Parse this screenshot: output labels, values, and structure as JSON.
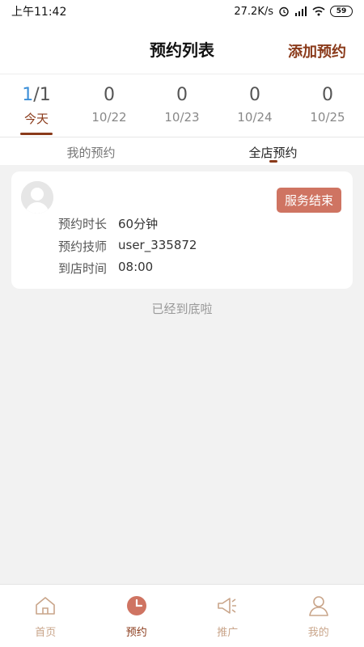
{
  "status_bar": {
    "time": "上午11:42",
    "speed": "27.2K/s",
    "battery": "59"
  },
  "header": {
    "title": "预约列表",
    "action_label": "添加预约"
  },
  "date_strip": [
    {
      "count_highlight": "1",
      "count_rest": "/1",
      "label": "今天",
      "active": true
    },
    {
      "count_highlight": "",
      "count_rest": "0",
      "label": "10/22",
      "active": false
    },
    {
      "count_highlight": "",
      "count_rest": "0",
      "label": "10/23",
      "active": false
    },
    {
      "count_highlight": "",
      "count_rest": "0",
      "label": "10/24",
      "active": false
    },
    {
      "count_highlight": "",
      "count_rest": "0",
      "label": "10/25",
      "active": false
    }
  ],
  "tabs": {
    "mine": "我的预约",
    "store": "全店预约"
  },
  "appointment": {
    "status": "服务结束",
    "rows": [
      {
        "label": "预约时长",
        "value": "60分钟"
      },
      {
        "label": "预约技师",
        "value": "user_335872"
      },
      {
        "label": "到店时间",
        "value": "08:00"
      }
    ]
  },
  "footer_note": "已经到底啦",
  "tabbar": {
    "home": "首页",
    "appointments": "预约",
    "promote": "推广",
    "mine": "我的"
  },
  "colors": {
    "accent": "#8a3a1a",
    "badge": "#cf7462",
    "highlight": "#3c8fd8",
    "tab_inactive": "#c9a58a"
  }
}
